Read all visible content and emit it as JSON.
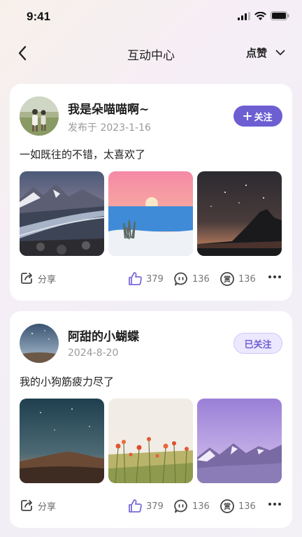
{
  "status_bar": {
    "time": "9:41"
  },
  "nav": {
    "title": "互动中心",
    "filter_label": "点赞"
  },
  "posts": [
    {
      "username": "我是朵喵喵啊~",
      "date": "发布于 2023-1-16",
      "follow_label": "关注",
      "followed": false,
      "text": "一如既往的不错，太喜欢了",
      "share_label": "分享",
      "likes": "379",
      "comments": "136",
      "rewards": "136"
    },
    {
      "username": "阿甜的小蝴蝶",
      "date": "2024-8-20",
      "follow_label": "已关注",
      "followed": true,
      "text": "我的小狗筋疲力尽了",
      "share_label": "分享",
      "likes": "379",
      "comments": "136",
      "rewards": "136"
    }
  ],
  "colors": {
    "accent": "#6d5fd2",
    "like_icon": "#7a6bd8"
  },
  "icons": {
    "back": "chevron-left-icon",
    "filter": "chevron-down-icon",
    "share": "share-icon",
    "like": "thumbs-up-icon",
    "comment": "comment-icon",
    "reward": "reward-icon",
    "more": "more-icon"
  }
}
